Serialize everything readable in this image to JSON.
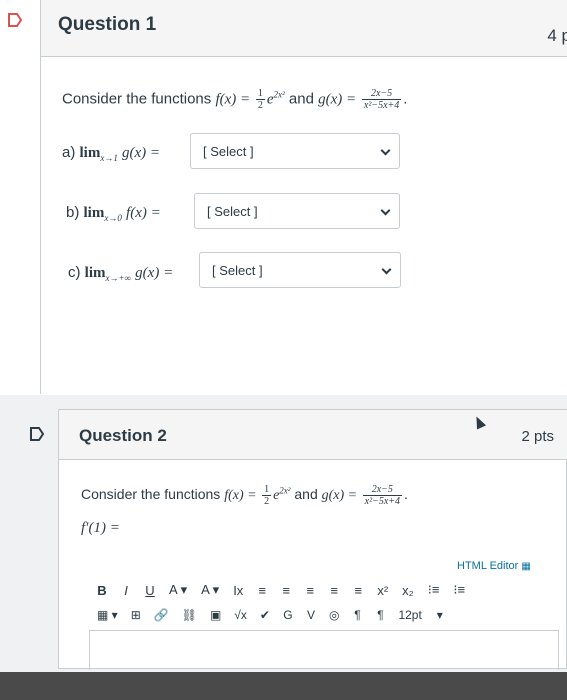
{
  "question1": {
    "title": "Question 1",
    "points": "4 p",
    "statement_prefix": "Consider the functions",
    "f_def": "f(x) = ",
    "f_frac_num": "1",
    "f_frac_den": "2",
    "f_exp_base": "e",
    "f_exponent": "2x²",
    "and_text": "and",
    "g_def": "g(x) = ",
    "g_frac_num": "2x−5",
    "g_frac_den": "x²−5x+4",
    "period": ".",
    "parts": [
      {
        "label": "a)",
        "lim": "lim",
        "sub": "x→1",
        "func": "g(x) =",
        "select": "[ Select ]"
      },
      {
        "label": "b)",
        "lim": "lim",
        "sub": "x→0",
        "func": "f(x) =",
        "select": "[ Select ]"
      },
      {
        "label": "c)",
        "lim": "lim",
        "sub": "x→+∞",
        "func": "g(x) =",
        "select": "[ Select ]"
      }
    ]
  },
  "question2": {
    "title": "Question 2",
    "points": "2 pts",
    "statement_prefix": "Consider the functions",
    "f_def": "f(x) = ",
    "f_frac_num": "1",
    "f_frac_den": "2",
    "f_exp_base": "e",
    "f_exponent": "2x²",
    "and_text": "and",
    "g_def": "g(x) = ",
    "g_frac_num": "2x−5",
    "g_frac_den": "x²−5x+4",
    "period": ".",
    "prompt": "f′(1) =",
    "html_editor": "HTML Editor",
    "toolbar1": [
      "B",
      "I",
      "U",
      "A ▾",
      "A ▾",
      "Ix",
      "≡",
      "≡",
      "≡",
      "≡",
      "≡",
      "x²",
      "x₂",
      "⁝≡",
      "⁝≡"
    ],
    "toolbar2": [
      "▦ ▾",
      "⊞",
      "🔗",
      "⛓",
      "▣",
      "√x",
      "✔",
      "G",
      "V",
      "◎",
      "¶",
      "¶",
      "12pt",
      "▾"
    ]
  }
}
